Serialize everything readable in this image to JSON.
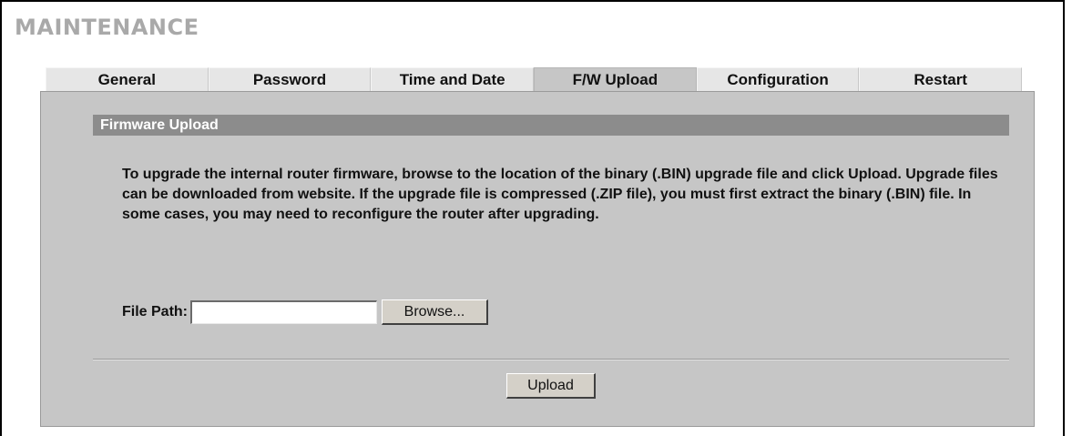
{
  "page": {
    "title": "MAINTENANCE"
  },
  "tabs": [
    {
      "label": "General",
      "active": false
    },
    {
      "label": "Password",
      "active": false
    },
    {
      "label": "Time and Date",
      "active": false
    },
    {
      "label": "F/W Upload",
      "active": true
    },
    {
      "label": "Configuration",
      "active": false
    },
    {
      "label": "Restart",
      "active": false
    }
  ],
  "section": {
    "title": "Firmware Upload",
    "description": "To upgrade the internal router firmware, browse to the location of the binary (.BIN) upgrade file and click Upload. Upgrade files can be downloaded from website. If the upgrade file is compressed (.ZIP file), you must first extract the binary (.BIN) file. In some cases, you may need to reconfigure the router after upgrading."
  },
  "file_path": {
    "label": "File Path:",
    "value": "",
    "browse_label": "Browse..."
  },
  "actions": {
    "upload_label": "Upload"
  },
  "colors": {
    "panel_bg": "#c6c6c6",
    "section_header_bg": "#8c8c8c",
    "title_color": "#a9a9a9"
  }
}
